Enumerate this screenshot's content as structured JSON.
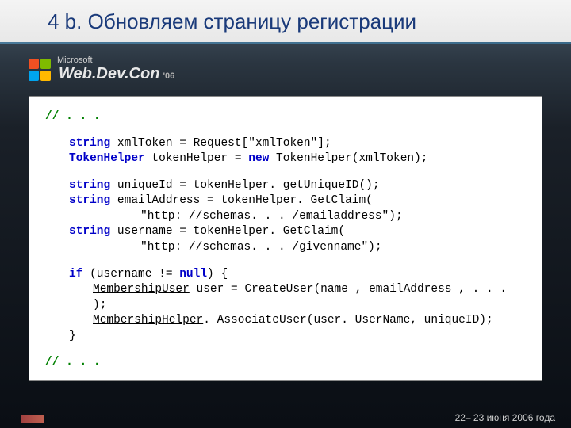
{
  "title": "4 b. Обновляем страницу регистрации",
  "logo": {
    "ms": "Microsoft",
    "brand": "Web.Dev.Con",
    "year": "'06"
  },
  "code": {
    "c0": "// . . .",
    "l1a": "string",
    "l1b": " xmlToken = Request[\"xmlToken\"];",
    "l2a": "TokenHelper",
    "l2b": " tokenHelper = ",
    "l2c": "new",
    "l2d": " TokenHelper",
    "l2e": "(xmlToken);",
    "l3a": "string",
    "l3b": " uniqueId = tokenHelper. getUniqueID();",
    "l4a": "string",
    "l4b": " emailAddress = tokenHelper. GetClaim(",
    "l4c": "\"http: //schemas. . . /emailaddress\");",
    "l5a": "string",
    "l5b": " username = tokenHelper. GetClaim(",
    "l5c": "\"http: //schemas. . . /givenname\");",
    "l6a": "if",
    "l6b": " (username != ",
    "l6c": "null",
    "l6d": ") {",
    "l7a": "MembershipUser",
    "l7b": " user = CreateUser(name , emailAddress , . . . );",
    "l8a": "MembershipHelper",
    "l8b": ". AssociateUser(user. UserName, uniqueID);",
    "l9": "}",
    "c1": "// . . ."
  },
  "footer": {
    "dates": "22– 23 июня 2006 года"
  }
}
